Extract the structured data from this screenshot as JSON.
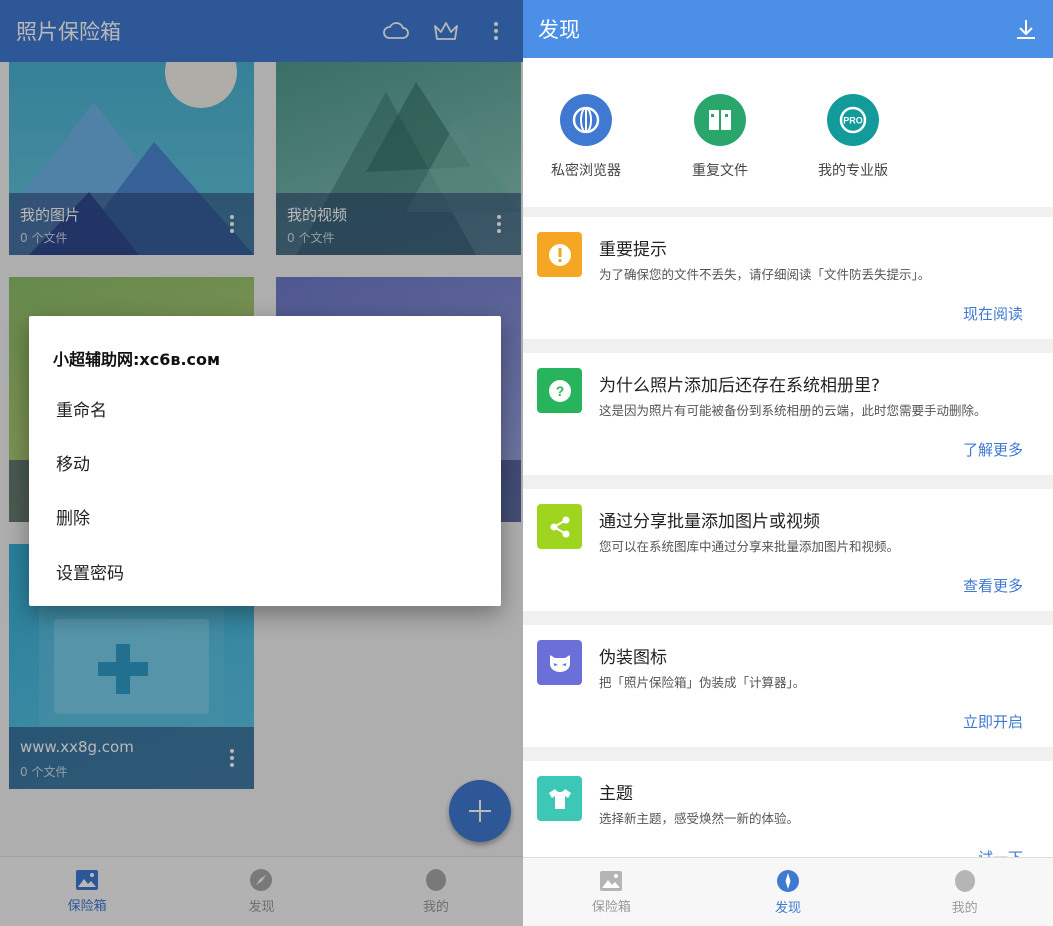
{
  "left": {
    "app_title": "照片保险箱",
    "actions": [
      {
        "icon": "cloud-icon"
      },
      {
        "icon": "crown-icon"
      },
      {
        "icon": "more-vert-icon"
      }
    ],
    "albums": [
      {
        "name": "我的图片",
        "count": "0 个文件"
      },
      {
        "name": "我的视频",
        "count": "0 个文件"
      },
      {
        "name": "",
        "count": ""
      },
      {
        "name": "",
        "count": ""
      },
      {
        "name": "www.xx8g.com",
        "count": "0 个文件"
      }
    ],
    "dialog": {
      "title": "小超辅助网:xc6в.сом",
      "items": [
        "重命名",
        "移动",
        "删除",
        "设置密码"
      ]
    },
    "fab_icon": "plus-icon",
    "bottom_nav": [
      {
        "label": "保险箱",
        "icon": "image-icon",
        "active": true
      },
      {
        "label": "发现",
        "icon": "compass-icon",
        "active": false
      },
      {
        "label": "我的",
        "icon": "person-icon",
        "active": false
      }
    ]
  },
  "right": {
    "title": "发现",
    "download_icon": "download-icon",
    "quick_actions": [
      {
        "label": "私密浏览器",
        "icon": "browser-globe-icon",
        "color": "#3f79d1"
      },
      {
        "label": "重复文件",
        "icon": "duplicate-files-icon",
        "color": "#2aa56b"
      },
      {
        "label": "我的专业版",
        "icon": "pro-badge-icon",
        "color": "#139b9b"
      }
    ],
    "tips": [
      {
        "title": "重要提示",
        "desc": "为了确保您的文件不丢失，请仔细阅读「文件防丢失提示」。",
        "link": "现在阅读",
        "icon": "alert-icon",
        "color": "#f5a623"
      },
      {
        "title": "为什么照片添加后还存在系统相册里?",
        "desc": "这是因为照片有可能被备份到系统相册的云端，此时您需要手动删除。",
        "link": "了解更多",
        "icon": "question-icon",
        "color": "#27b45c"
      },
      {
        "title": "通过分享批量添加图片或视频",
        "desc": "您可以在系统图库中通过分享来批量添加图片和视频。",
        "link": "查看更多",
        "icon": "share-icon",
        "color": "#9fd41f"
      },
      {
        "title": "伪装图标",
        "desc": "把「照片保险箱」伪装成「计算器」。",
        "link": "立即开启",
        "icon": "mask-icon",
        "color": "#6a70d8"
      },
      {
        "title": "主题",
        "desc": "选择新主题，感受焕然一新的体验。",
        "link": "试一下",
        "icon": "tshirt-icon",
        "color": "#3cc7b7"
      }
    ],
    "bottom_nav": [
      {
        "label": "保险箱",
        "icon": "image-icon",
        "active": false
      },
      {
        "label": "发现",
        "icon": "compass-icon",
        "active": true
      },
      {
        "label": "我的",
        "icon": "person-icon",
        "active": false
      }
    ]
  }
}
